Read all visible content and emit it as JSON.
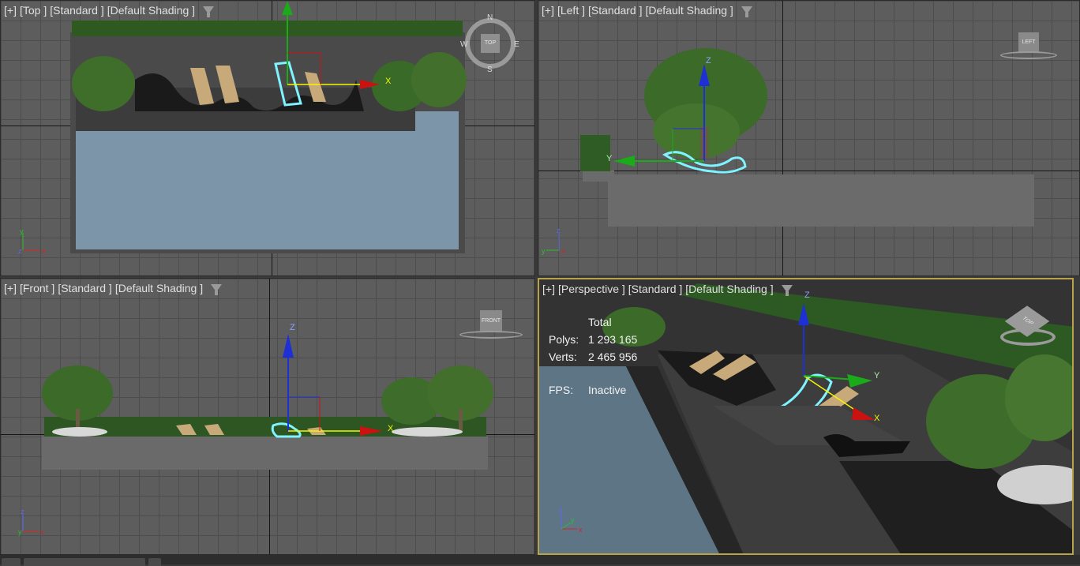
{
  "viewports": {
    "top": {
      "plus": "[+]",
      "view": "[Top ]",
      "mode": "[Standard ]",
      "shading": "[Default Shading ]",
      "compass": {
        "n": "N",
        "s": "S",
        "e": "E",
        "w": "W",
        "cube": "TOP"
      }
    },
    "left": {
      "plus": "[+]",
      "view": "[Left ]",
      "mode": "[Standard ]",
      "shading": "[Default Shading ]",
      "cube": "LEFT"
    },
    "front": {
      "plus": "[+]",
      "view": "[Front ]",
      "mode": "[Standard ]",
      "shading": "[Default Shading ]",
      "cube": "FRONT"
    },
    "perspective": {
      "plus": "[+]",
      "view": "[Perspective ]",
      "mode": "[Standard ]",
      "shading": "[Default Shading ]",
      "cube": "TOP"
    }
  },
  "stats": {
    "header": "Total",
    "polys_label": "Polys:",
    "polys_value": "1 293 165",
    "verts_label": "Verts:",
    "verts_value": "2 465 956",
    "fps_label": "FPS:",
    "fps_value": "Inactive"
  },
  "gizmo_axes": {
    "x": "X",
    "y": "Y",
    "z": "Z"
  },
  "colors": {
    "active_border": "#b8a24a",
    "selection": "#7ff3ff",
    "x_axis": "#cc1111",
    "y_axis": "#1aaa1a",
    "z_axis": "#1e2fd6",
    "gizmo_yellow": "#f5f500"
  }
}
